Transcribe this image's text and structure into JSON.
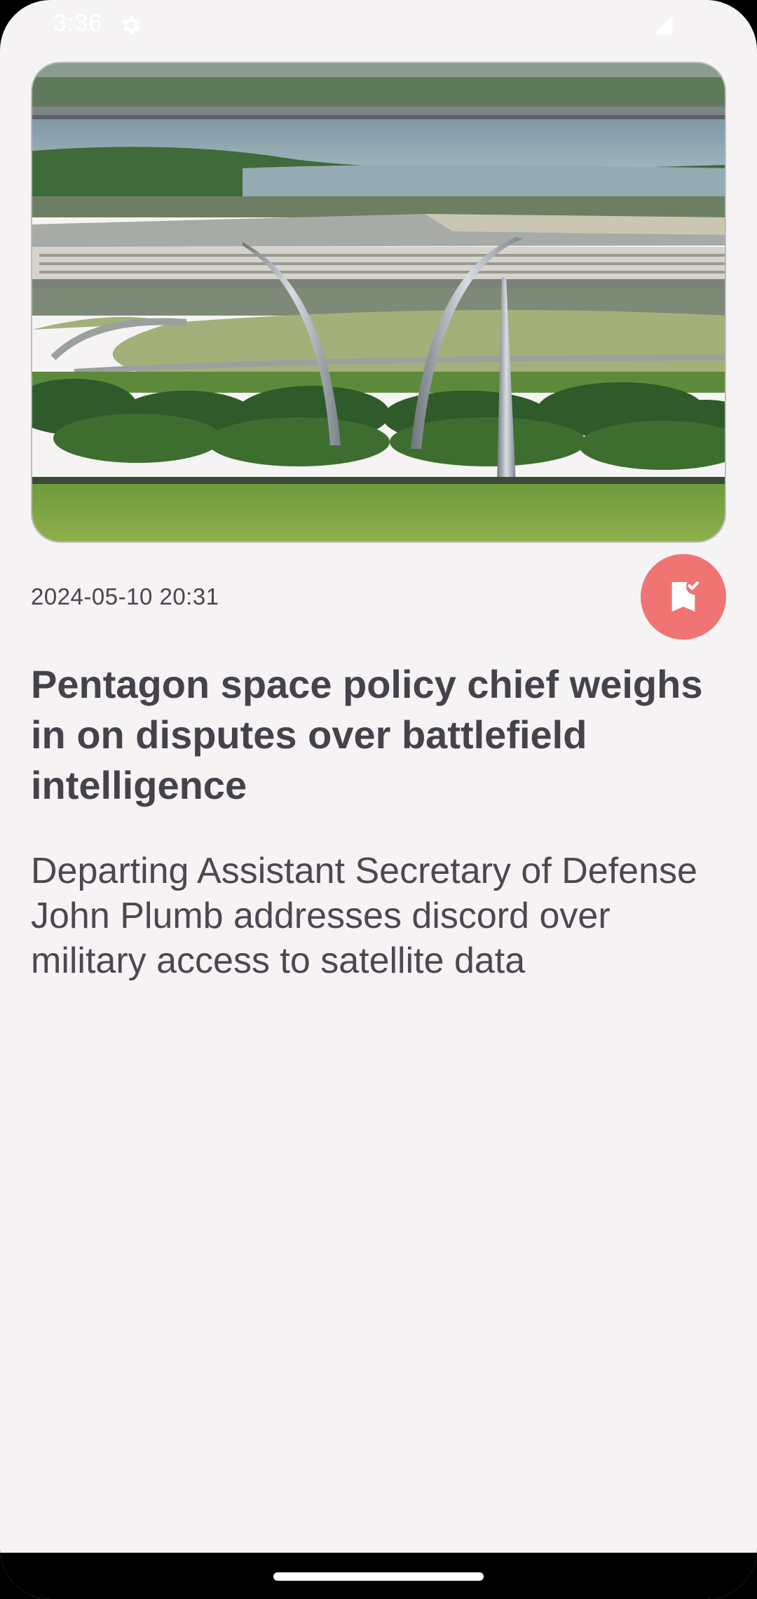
{
  "status_bar": {
    "time": "3:36",
    "icons": [
      "settings-gear-icon",
      "cell-signal-icon"
    ]
  },
  "article": {
    "image": {
      "subject": "aerial-photo"
    },
    "timestamp": "2024-05-10 20:31",
    "bookmark": {
      "icon": "bookmark-check-icon",
      "state": "saved",
      "color": "#f07473"
    },
    "title": "Pentagon space policy chief weighs in on disputes over battlefield intelligence",
    "summary": "Departing Assistant Secretary of Defense John Plumb addresses discord over military access to satellite data"
  },
  "nav": {
    "handle": "home-gesture-handle"
  },
  "colors": {
    "background": "#f6f3f4",
    "text_primary": "#45424b",
    "text_secondary": "#49454f",
    "accent": "#f07473"
  }
}
